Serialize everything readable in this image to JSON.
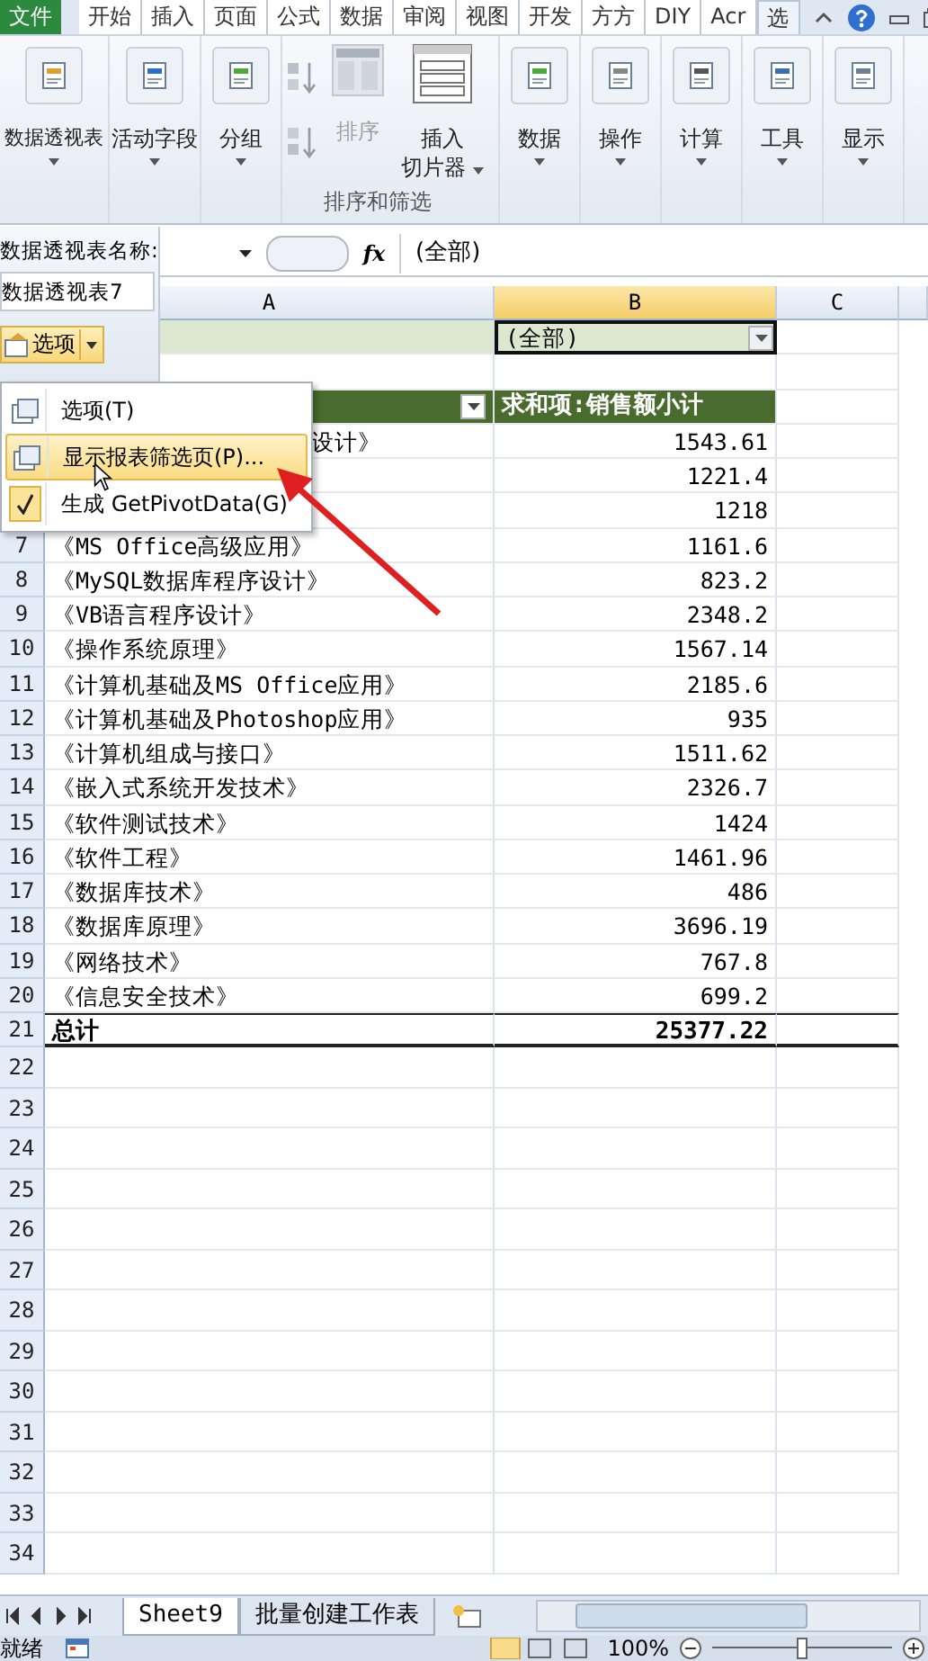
{
  "ribbon_tabs": [
    {
      "label": "文件",
      "selected": false
    },
    {
      "label": "开始",
      "selected": false
    },
    {
      "label": "插入",
      "selected": false
    },
    {
      "label": "页面",
      "selected": false
    },
    {
      "label": "公式",
      "selected": false
    },
    {
      "label": "数据",
      "selected": false
    },
    {
      "label": "审阅",
      "selected": false
    },
    {
      "label": "视图",
      "selected": false
    },
    {
      "label": "开发",
      "selected": false
    },
    {
      "label": "方方",
      "selected": false
    },
    {
      "label": "DIY",
      "selected": false
    },
    {
      "label": "Acr",
      "selected": false
    },
    {
      "label": "选",
      "selected": true
    }
  ],
  "ribbon_buttons": [
    {
      "kind": "large",
      "label": "数据透视表"
    },
    {
      "kind": "large",
      "label": "活动字段"
    },
    {
      "kind": "large",
      "label": "分组"
    },
    {
      "kind": "sort",
      "label": "排序"
    },
    {
      "kind": "slicer",
      "label": "插入",
      "label_2": "切片器"
    },
    {
      "kind": "large",
      "label": "数据"
    },
    {
      "kind": "large",
      "label": "操作"
    },
    {
      "kind": "large",
      "label": "计算"
    },
    {
      "kind": "large",
      "label": "工具"
    },
    {
      "kind": "large",
      "label": "显示"
    }
  ],
  "ribbon_group_label": "排序和筛选",
  "formula_bar": {
    "function_label": "fx",
    "formula": "(全部)"
  },
  "pivot_panel": {
    "name_label": "数据透视表名称:",
    "name_value": "数据透视表7",
    "options_button": "选项"
  },
  "columns": [
    {
      "label": "A",
      "selected": false
    },
    {
      "label": "B",
      "selected": true
    },
    {
      "label": "C",
      "selected": false
    }
  ],
  "filter_value": "(全部)",
  "value_header": "求和项:销售额小计",
  "rows": [
    {
      "kind": "partial",
      "name": "设计》",
      "value": "1543.61"
    },
    {
      "kind": "covered",
      "value": "1221.4"
    },
    {
      "kind": "covered",
      "value": "1218"
    },
    {
      "kind": "row",
      "num": "7",
      "name": "《MS Office高级应用》",
      "value": "1161.6"
    },
    {
      "kind": "row",
      "num": "8",
      "name": "《MySQL数据库程序设计》",
      "value": "823.2"
    },
    {
      "kind": "row",
      "num": "9",
      "name": "《VB语言程序设计》",
      "value": "2348.2"
    },
    {
      "kind": "row",
      "num": "10",
      "name": "《操作系统原理》",
      "value": "1567.14"
    },
    {
      "kind": "row",
      "num": "11",
      "name": "《计算机基础及MS Office应用》",
      "value": "2185.6"
    },
    {
      "kind": "row",
      "num": "12",
      "name": "《计算机基础及Photoshop应用》",
      "value": "935"
    },
    {
      "kind": "row",
      "num": "13",
      "name": "《计算机组成与接口》",
      "value": "1511.62"
    },
    {
      "kind": "row",
      "num": "14",
      "name": "《嵌入式系统开发技术》",
      "value": "2326.7"
    },
    {
      "kind": "row",
      "num": "15",
      "name": "《软件测试技术》",
      "value": "1424"
    },
    {
      "kind": "row",
      "num": "16",
      "name": "《软件工程》",
      "value": "1461.96"
    },
    {
      "kind": "row",
      "num": "17",
      "name": "《数据库技术》",
      "value": "486"
    },
    {
      "kind": "row",
      "num": "18",
      "name": "《数据库原理》",
      "value": "3696.19"
    },
    {
      "kind": "row",
      "num": "19",
      "name": "《网络技术》",
      "value": "767.8"
    },
    {
      "kind": "row",
      "num": "20",
      "name": "《信息安全技术》",
      "value": "699.2"
    }
  ],
  "total": {
    "num": "21",
    "name": "总计",
    "value": "25377.22"
  },
  "empty_rows": [
    "22",
    "23",
    "24",
    "25",
    "26",
    "27",
    "28",
    "29",
    "30",
    "31",
    "32",
    "33",
    "34"
  ],
  "context_menu": [
    {
      "label": "选项(T)",
      "selected": false,
      "checked": false
    },
    {
      "label": "显示报表筛选页(P)...",
      "selected": true,
      "checked": false
    },
    {
      "label": "生成 GetPivotData(G)",
      "selected": false,
      "checked": true
    }
  ],
  "sheet_tabs": [
    {
      "label": "Sheet9",
      "selected": true
    },
    {
      "label": "批量创建工作表",
      "selected": false
    }
  ],
  "status": {
    "text": "就绪",
    "zoom": "100%",
    "slider": {
      "level": 0.5
    }
  }
}
